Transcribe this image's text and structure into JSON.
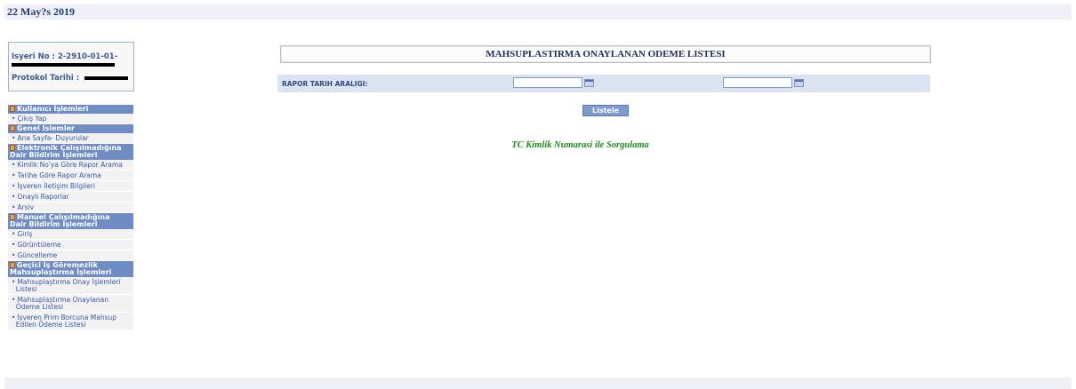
{
  "header": {
    "date": "22 May?s 2019"
  },
  "info": {
    "isyeri_label": "Isyeri No : 2-2910-01-01-",
    "protokol_label": "Protokol Tarihi :"
  },
  "sidebar": {
    "sections": [
      {
        "title": "Kullanıcı İşlemleri",
        "items": [
          "Çıkış Yap"
        ]
      },
      {
        "title": "Genel Islemler",
        "items": [
          "Ana Sayfa- Duyurular"
        ]
      },
      {
        "title_lines": [
          "Elektronik Çalışılmadığına",
          "Dair Bildirim İşlemleri"
        ],
        "items": [
          "Kimlik No'ya Göre Rapor Arama",
          "Tarihe Göre Rapor Arama",
          "İşveren İletişim Bilgileri",
          "Onaylı Raporlar",
          "Arsiv"
        ]
      },
      {
        "title_lines": [
          "Manuel Çalışılmadığına",
          "Dair Bildirim İşlemleri"
        ],
        "items": [
          "Giriş",
          "Görüntüleme",
          "Güncelleme"
        ]
      },
      {
        "title_lines": [
          "Geçici İş Göremezlik",
          "Mahsuplaştırma İşlemleri"
        ],
        "items_lines": [
          [
            "Mahsuplaştırma Onay İşlemleri",
            "Listesi"
          ],
          [
            "Mahsuplaştırma Onaylanan",
            "Ödeme Listesi"
          ],
          [
            "İşveren Prim Borcuna Mahsup",
            "Edilen Ödeme Listesi"
          ]
        ]
      }
    ]
  },
  "main": {
    "title": "MAHSUPLASTIRMA ONAYLANAN ODEME LISTESI",
    "filter_label": "RAPOR TARIH ARALIGI:",
    "date_start": "",
    "date_end": "",
    "list_button": "Listele",
    "tc_link": "TC Kimlik Numarasi ile Sorgulama"
  },
  "colors": {
    "section_header": "#6f8dc2",
    "link": "#3957a6",
    "green": "#1a8a1a"
  }
}
